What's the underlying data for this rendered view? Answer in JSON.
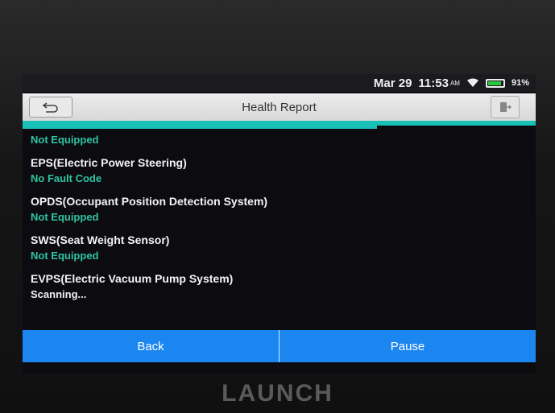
{
  "status_bar": {
    "date": "Mar 29",
    "time": "11:53",
    "ampm": "AM",
    "battery": "91%",
    "battery_level": 0.91
  },
  "header": {
    "title": "Health Report"
  },
  "progress_fraction": 0.69,
  "items": [
    {
      "name": "",
      "status": "Not Equipped",
      "status_color": "#2ec4a2"
    },
    {
      "name": "EPS(Electric Power Steering)",
      "status": "No Fault Code",
      "status_color": "#2ec4a2"
    },
    {
      "name": "OPDS(Occupant Position Detection System)",
      "status": "Not Equipped",
      "status_color": "#2ec4a2"
    },
    {
      "name": "SWS(Seat Weight Sensor)",
      "status": "Not Equipped",
      "status_color": "#2ec4a2"
    },
    {
      "name": "EVPS(Electric Vacuum Pump System)",
      "status": "Scanning...",
      "status_color": "#f0f0f0"
    }
  ],
  "footer": {
    "back_label": "Back",
    "pause_label": "Pause"
  },
  "brand": "LAUNCH",
  "colors": {
    "accent": "#18c0b8",
    "button": "#1b86f0"
  }
}
